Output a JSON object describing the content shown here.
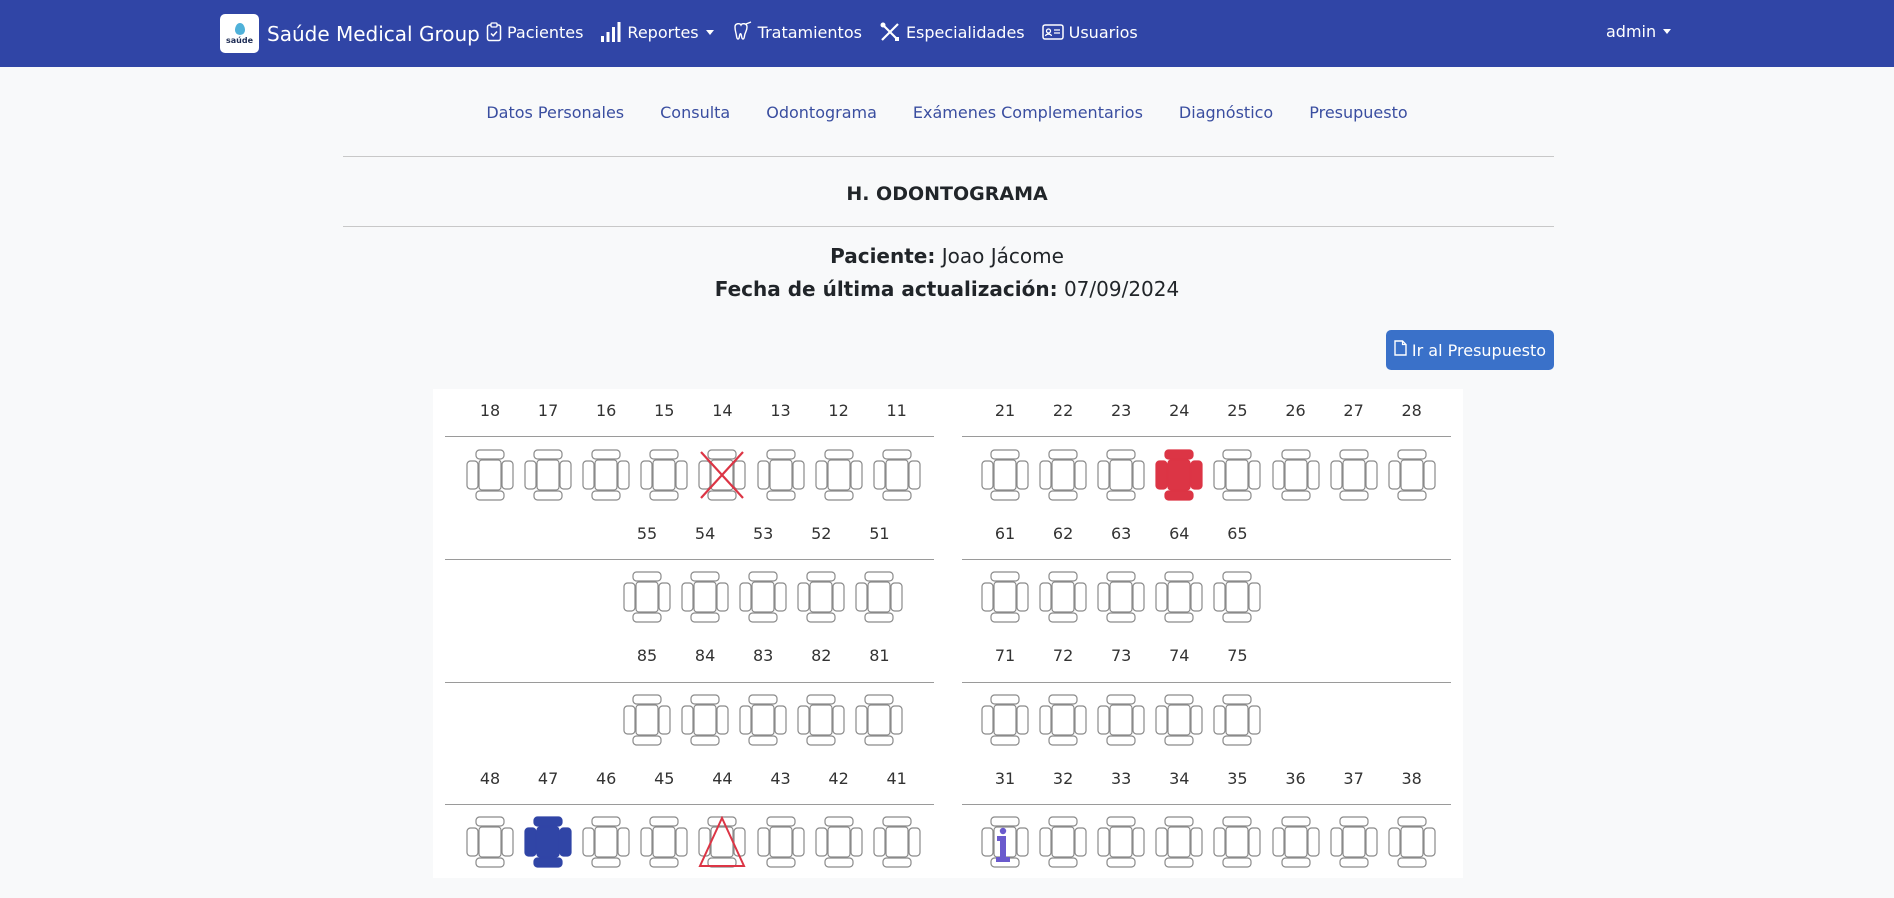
{
  "navbar": {
    "brand_name": "Saúde Medical Group",
    "logo_text": "saúde",
    "items": [
      {
        "label": "Pacientes",
        "icon": "clipboard-icon"
      },
      {
        "label": "Reportes",
        "icon": "bar-chart-icon",
        "dropdown": true
      },
      {
        "label": "Tratamientos",
        "icon": "tooth-icon"
      },
      {
        "label": "Especialidades",
        "icon": "tools-icon"
      },
      {
        "label": "Usuarios",
        "icon": "id-card-icon"
      }
    ],
    "user_label": "admin"
  },
  "tabs": [
    "Datos Personales",
    "Consulta",
    "Odontograma",
    "Exámenes Complementarios",
    "Diagnóstico",
    "Presupuesto"
  ],
  "section_title": "H. ODONTOGRAMA",
  "patient": {
    "label": "Paciente:",
    "name": "Joao Jácome"
  },
  "updated": {
    "label": "Fecha de última actualización:",
    "date": "07/09/2024"
  },
  "budget_button": "Ir al Presupuesto",
  "odontogram": {
    "upper_right_permanent": [
      "18",
      "17",
      "16",
      "15",
      "14",
      "13",
      "12",
      "11"
    ],
    "upper_left_permanent": [
      "21",
      "22",
      "23",
      "24",
      "25",
      "26",
      "27",
      "28"
    ],
    "upper_right_deciduous": [
      "55",
      "54",
      "53",
      "52",
      "51"
    ],
    "upper_left_deciduous": [
      "61",
      "62",
      "63",
      "64",
      "65"
    ],
    "lower_right_deciduous": [
      "85",
      "84",
      "83",
      "82",
      "81"
    ],
    "lower_left_deciduous": [
      "71",
      "72",
      "73",
      "74",
      "75"
    ],
    "lower_right_permanent": [
      "48",
      "47",
      "46",
      "45",
      "44",
      "43",
      "42",
      "41"
    ],
    "lower_left_permanent": [
      "31",
      "32",
      "33",
      "34",
      "35",
      "36",
      "37",
      "38"
    ],
    "marked_teeth": [
      {
        "tooth": "14",
        "mark": "extraction-x",
        "color": "#dc3545"
      },
      {
        "tooth": "24",
        "mark": "filled",
        "color": "#dc3545"
      },
      {
        "tooth": "47",
        "mark": "filled",
        "color": "#3045a6"
      },
      {
        "tooth": "44",
        "mark": "triangle",
        "color": "#dc3545"
      },
      {
        "tooth": "31",
        "mark": "info-i",
        "color": "#6a5acd"
      }
    ]
  },
  "colors": {
    "navbar": "#3045a6",
    "button": "#3a71c9",
    "tab_text": "#3a4ea0",
    "red": "#dc3545"
  }
}
